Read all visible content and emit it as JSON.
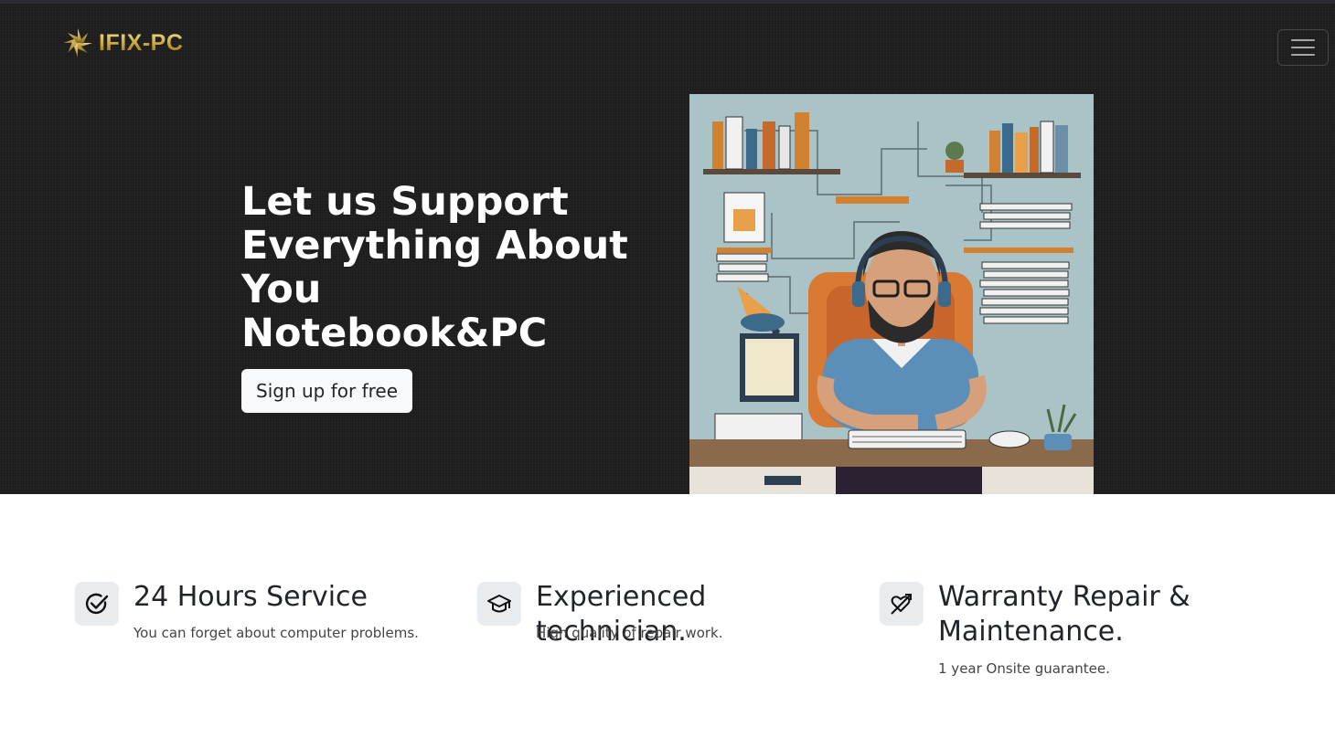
{
  "navbar": {
    "brand_name": "IFIX-PC",
    "brand_colors": [
      "#f4e38a",
      "#c9a233",
      "#8b6a1a"
    ],
    "logo_icon": "gold-star-logo-icon",
    "menu_icon": "hamburger-menu-icon"
  },
  "hero": {
    "headline_lines": [
      "Let us Support",
      "Everything About",
      "You",
      "Notebook&PC"
    ],
    "cta_label": "Sign up for free",
    "image_subject": "illustration of technician with headset at desk",
    "background_color": "#1d1d1d"
  },
  "features": [
    {
      "icon": "check-circle-icon",
      "title": "24 Hours Service",
      "description": "You can forget about computer problems."
    },
    {
      "icon": "graduation-cap-icon",
      "title": "Experienced technician.",
      "description": "High quality of repair work."
    },
    {
      "icon": "heart-arrow-icon",
      "title": "Warranty Repair & Maintenance.",
      "description": "1 year Onsite guarantee."
    }
  ]
}
